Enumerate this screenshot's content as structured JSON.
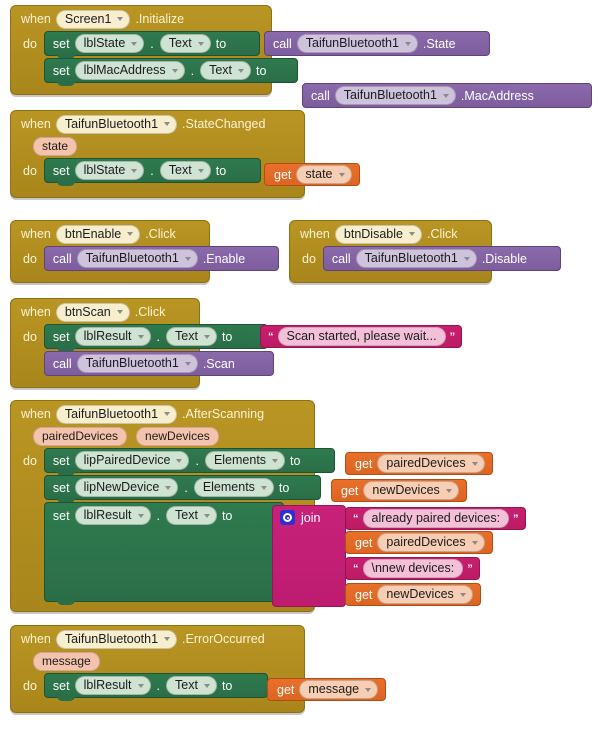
{
  "meta": {
    "app": "MIT App Inventor Blocks Editor",
    "canvas_background": "#ffffff"
  },
  "colors": {
    "event_block": "#B18E1E",
    "set_block": "#2F7A4F",
    "call_block": "#7D5D9E",
    "get_block": "#E8702A",
    "text_block": "#C81F6E",
    "join_block": "#C8217A",
    "mutator_icon": "#2B30D0"
  },
  "labels": {
    "when": "when",
    "do": "do",
    "set": "set",
    "call": "call",
    "get": "get",
    "to": "to",
    "join": "join",
    "dot": "."
  },
  "blocks": [
    {
      "id": "screen1-initialize",
      "kind": "event",
      "component": "Screen1",
      "event": ".Initialize",
      "params": [],
      "body": [
        {
          "kind": "set",
          "component": "lblState",
          "property": "Text",
          "value": {
            "kind": "call",
            "component": "TaifunBluetooth1",
            "method": ".State"
          }
        },
        {
          "kind": "set",
          "component": "lblMacAddress",
          "property": "Text",
          "value": {
            "kind": "call",
            "component": "TaifunBluetooth1",
            "method": ".MacAddress"
          }
        }
      ]
    },
    {
      "id": "bt-statechanged",
      "kind": "event",
      "component": "TaifunBluetooth1",
      "event": ".StateChanged",
      "params": [
        "state"
      ],
      "body": [
        {
          "kind": "set",
          "component": "lblState",
          "property": "Text",
          "value": {
            "kind": "get",
            "variable": "state"
          }
        }
      ]
    },
    {
      "id": "btnenable-click",
      "kind": "event",
      "component": "btnEnable",
      "event": ".Click",
      "params": [],
      "body": [
        {
          "kind": "call-statement",
          "component": "TaifunBluetooth1",
          "method": ".Enable"
        }
      ]
    },
    {
      "id": "btndisable-click",
      "kind": "event",
      "component": "btnDisable",
      "event": ".Click",
      "params": [],
      "body": [
        {
          "kind": "call-statement",
          "component": "TaifunBluetooth1",
          "method": ".Disable"
        }
      ]
    },
    {
      "id": "btnscan-click",
      "kind": "event",
      "component": "btnScan",
      "event": ".Click",
      "params": [],
      "body": [
        {
          "kind": "set",
          "component": "lblResult",
          "property": "Text",
          "value": {
            "kind": "text",
            "string": "Scan started, please wait..."
          }
        },
        {
          "kind": "call-statement",
          "component": "TaifunBluetooth1",
          "method": ".Scan"
        }
      ]
    },
    {
      "id": "bt-afterscanning",
      "kind": "event",
      "component": "TaifunBluetooth1",
      "event": ".AfterScanning",
      "params": [
        "pairedDevices",
        "newDevices"
      ],
      "body": [
        {
          "kind": "set",
          "component": "lipPairedDevice",
          "property": "Elements",
          "value": {
            "kind": "get",
            "variable": "pairedDevices"
          }
        },
        {
          "kind": "set",
          "component": "lipNewDevice",
          "property": "Elements",
          "value": {
            "kind": "get",
            "variable": "newDevices"
          }
        },
        {
          "kind": "set",
          "component": "lblResult",
          "property": "Text",
          "value": {
            "kind": "join",
            "items": [
              {
                "kind": "text",
                "string": "already paired devices:"
              },
              {
                "kind": "get",
                "variable": "pairedDevices"
              },
              {
                "kind": "text",
                "string": "\\nnew devices:"
              },
              {
                "kind": "get",
                "variable": "newDevices"
              }
            ]
          }
        }
      ]
    },
    {
      "id": "bt-erroroccurred",
      "kind": "event",
      "component": "TaifunBluetooth1",
      "event": ".ErrorOccurred",
      "params": [
        "message"
      ],
      "body": [
        {
          "kind": "set",
          "component": "lblResult",
          "property": "Text",
          "value": {
            "kind": "get",
            "variable": "message"
          }
        }
      ]
    }
  ]
}
